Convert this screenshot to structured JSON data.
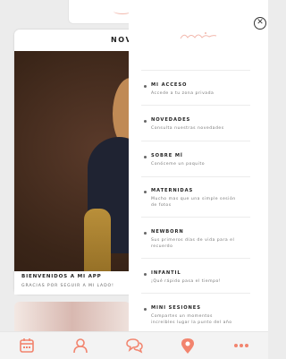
{
  "background_card": {
    "title": "NOVEDADES",
    "caption_title": "BIENVENIDOS A MI APP",
    "caption_subtitle": "GRACIAS POR SEGUIR A MI LADO!"
  },
  "menu": {
    "items": [
      {
        "title": "MI ACCESO",
        "description": "Accede a tu zona privada"
      },
      {
        "title": "NOVEDADES",
        "description": "Consulta nuestras novedades"
      },
      {
        "title": "SOBRE MÍ",
        "description": "Conóceme un poquito"
      },
      {
        "title": "MATERNIDAS",
        "description": "Mucho mas que una simple sesión de fotos"
      },
      {
        "title": "NEWBORN",
        "description": "Sus primeros días de vida para el recuerdo"
      },
      {
        "title": "INFANTIL",
        "description": "¡Qué rápido pasa el tiempo!"
      },
      {
        "title": "MINI SESIONES",
        "description": "Compartes un momentos increíbles lugar la punto del año"
      }
    ],
    "close_icon": "close-icon"
  },
  "tabbar": {
    "accent_color": "#f2846e",
    "icons": [
      "calendar-icon",
      "user-icon",
      "chat-icon",
      "location-pin-icon",
      "more-icon"
    ]
  }
}
